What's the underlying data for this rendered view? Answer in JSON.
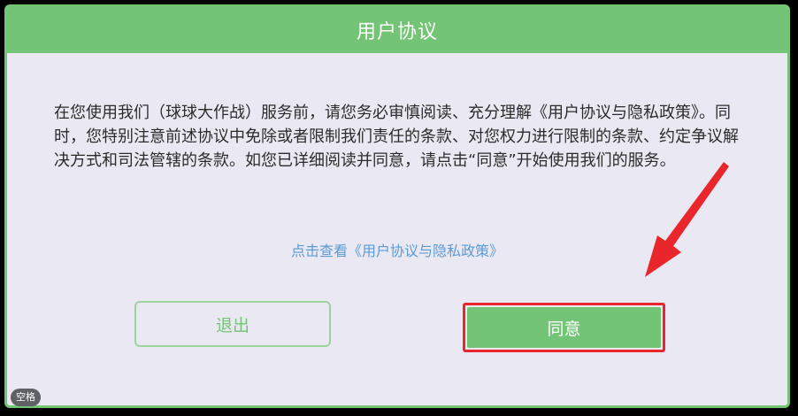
{
  "dialog": {
    "title": "用户协议",
    "body": "在您使用我们（球球大作战）服务前，请您务必审慎阅读、充分理解《用户协议与隐私政策》。同时，您特别注意前述协议中免除或者限制我们责任的条款、对您权力进行限制的条款、约定争议解决方式和司法管辖的条款。如您已详细阅读并同意，请点击“同意”开始使用我们的服务。",
    "policy_link": "点击查看《用户协议与隐私政策》",
    "exit_label": "退出",
    "agree_label": "同意"
  },
  "overlay": {
    "space_key_label": "空格",
    "arrow_icon": "red-arrow-pointer",
    "highlight_color": "#e8262b"
  },
  "colors": {
    "accent": "#74c476",
    "background": "#eae9f3",
    "link": "#5b9bd5"
  }
}
